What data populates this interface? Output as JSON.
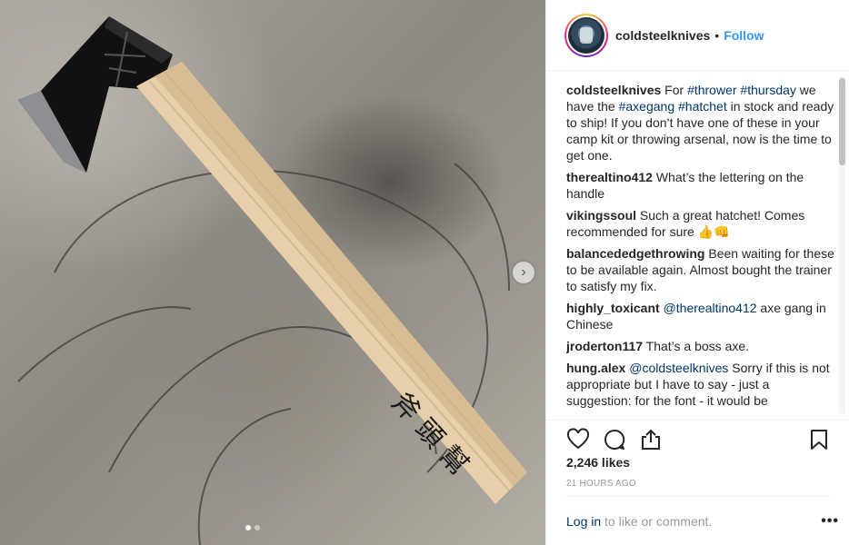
{
  "post": {
    "username": "coldsteelknives",
    "separator": "•",
    "follow_label": "Follow"
  },
  "photo": {
    "handle_text": "斧 頭 幫",
    "carousel_next": "›"
  },
  "comments": [
    {
      "user": "coldsteelknives",
      "parts": [
        {
          "t": "For "
        },
        {
          "t": "#thrower",
          "tag": true
        },
        {
          "t": " "
        },
        {
          "t": "#thursday",
          "tag": true
        },
        {
          "t": " we have the "
        },
        {
          "t": "#axegang",
          "tag": true
        },
        {
          "t": " "
        },
        {
          "t": "#hatchet",
          "tag": true
        },
        {
          "t": " in stock and ready to ship! If you don’t have one of these in your camp kit or throwing arsenal, now is the time to get one."
        }
      ]
    },
    {
      "user": "therealtino412",
      "parts": [
        {
          "t": "What’s the lettering on the handle"
        }
      ]
    },
    {
      "user": "vikingssoul",
      "parts": [
        {
          "t": "Such a great hatchet! Comes recommended for sure 👍👊"
        }
      ]
    },
    {
      "user": "balancededgethrowing",
      "parts": [
        {
          "t": "Been waiting for these to be available again. Almost bought the trainer to satisfy my fix."
        }
      ]
    },
    {
      "user": "highly_toxicant",
      "parts": [
        {
          "t": "@therealtino412",
          "tag": true
        },
        {
          "t": " axe gang in Chinese"
        }
      ]
    },
    {
      "user": "jroderton117",
      "parts": [
        {
          "t": "That’s a boss axe."
        }
      ]
    },
    {
      "user": "hung.alex",
      "parts": [
        {
          "t": "@coldsteelknives",
          "tag": true
        },
        {
          "t": " Sorry if this is not appropriate but I have to say - just a suggestion: for the font - it would be"
        }
      ]
    }
  ],
  "stats": {
    "likes": "2,246 likes",
    "time": "21 HOURS AGO"
  },
  "footer": {
    "login_label": "Log in",
    "rest_text": " to like or comment.",
    "more_label": "•••"
  },
  "icons": {
    "like": "heart-icon",
    "comment": "comment-icon",
    "share": "share-icon",
    "save": "bookmark-icon"
  }
}
